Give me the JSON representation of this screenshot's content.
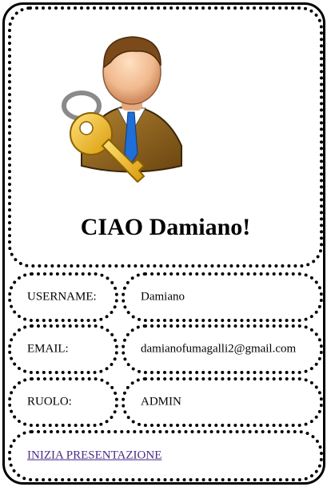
{
  "header": {
    "avatar_icon": "user-with-key-icon",
    "greeting": "CIAO Damiano!"
  },
  "fields": [
    {
      "label": "USERNAME:",
      "value": "Damiano"
    },
    {
      "label": "EMAIL:",
      "value": "damianofumagalli2@gmail.com"
    },
    {
      "label": "RUOLO:",
      "value": "ADMIN"
    }
  ],
  "footer": {
    "link_label": "INIZIA PRESENTAZIONE"
  },
  "colors": {
    "border": "#000000",
    "link": "#4b2a8a",
    "key": "#f2b81c",
    "tie": "#1f6fd6",
    "jacket": "#8a5f17"
  }
}
